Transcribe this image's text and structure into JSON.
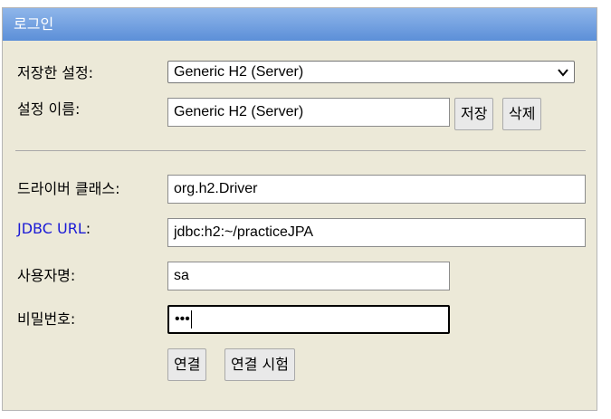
{
  "window": {
    "title": "로그인"
  },
  "form": {
    "saved_settings": {
      "label": "저장한 설정:",
      "value": "Generic H2 (Server)"
    },
    "setting_name": {
      "label": "설정 이름:",
      "value": "Generic H2 (Server)"
    },
    "save_button": "저장",
    "delete_button": "삭제",
    "driver_class": {
      "label": "드라이버 클래스:",
      "value": "org.h2.Driver"
    },
    "jdbc_url": {
      "label_link": "JDBC URL",
      "label_suffix": ":",
      "value": "jdbc:h2:~/practiceJPA"
    },
    "username": {
      "label": "사용자명:",
      "value": "sa"
    },
    "password": {
      "label": "비밀번호:",
      "masked": "•••"
    },
    "connect_button": "연결",
    "test_button": "연결 시험"
  }
}
